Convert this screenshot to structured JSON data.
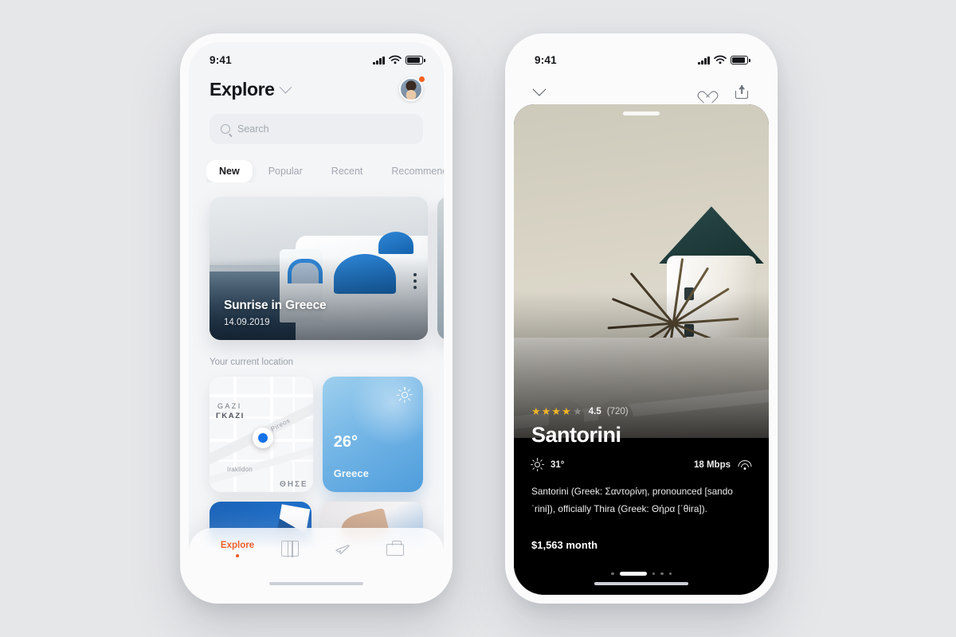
{
  "explore": {
    "status_bar": {
      "time": "9:41",
      "signal_icon": "signal-bars-icon",
      "wifi_icon": "wifi-icon",
      "battery_icon": "battery-icon"
    },
    "header": {
      "title": "Explore",
      "chevron_icon": "chevron-down-icon",
      "avatar_icon": "avatar",
      "badge_icon": "notification-badge"
    },
    "search": {
      "placeholder": "Search",
      "icon": "search-icon"
    },
    "tabs": [
      {
        "label": "New",
        "active": true
      },
      {
        "label": "Popular",
        "active": false
      },
      {
        "label": "Recent",
        "active": false
      },
      {
        "label": "Recommended",
        "active": false
      }
    ],
    "hero_card": {
      "title": "Sunrise in Greece",
      "date": "14.09.2019",
      "menu_icon": "kebab-menu-icon"
    },
    "section_label": "Your current location",
    "map_widget": {
      "labels": {
        "area_en": "GAZI",
        "area_gr": "ΓΚΑΖΙ",
        "street_main": "Pireos",
        "street_second": "Iraklidon",
        "district": "ΘΗΣΕ"
      },
      "pin_icon": "location-pin-icon"
    },
    "weather_widget": {
      "temperature": "26°",
      "place": "Greece",
      "icon": "sun-icon"
    },
    "tabbar": [
      {
        "label": "Explore",
        "icon": "explore-label",
        "active": true
      },
      {
        "label": "",
        "icon": "map-icon",
        "active": false
      },
      {
        "label": "",
        "icon": "plane-icon",
        "active": false
      },
      {
        "label": "",
        "icon": "briefcase-icon",
        "active": false
      }
    ],
    "accent_color": "#ef5f2a"
  },
  "detail": {
    "status_bar": {
      "time": "9:41",
      "signal_icon": "signal-bars-icon",
      "wifi_icon": "wifi-icon",
      "battery_icon": "battery-icon"
    },
    "header": {
      "back_icon": "chevron-down-icon",
      "favorite_icon": "heart-icon",
      "share_icon": "share-icon"
    },
    "rating": {
      "stars_filled": 4,
      "stars_total": 5,
      "value": "4.5",
      "count": "(720)"
    },
    "title": "Santorini",
    "weather": {
      "icon": "sun-icon",
      "temperature": "31°"
    },
    "network": {
      "speed": "18 Mbps",
      "icon": "wifi-icon"
    },
    "description": "Santorini (Greek: Σαντορίνη, pronounced [sando ˈrini]), officially Thira (Greek: Θήρα [ˈθira]).",
    "price": "$1,563 month",
    "pager": {
      "total": 5,
      "active_index": 1
    }
  }
}
